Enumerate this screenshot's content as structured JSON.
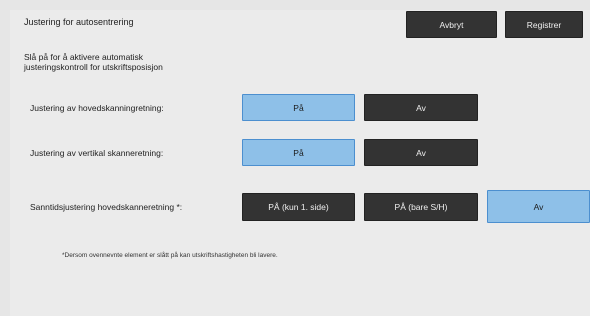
{
  "header": {
    "title": "Justering for autosentrering",
    "cancel_label": "Avbryt",
    "register_label": "Registrer"
  },
  "description": "Slå på for å aktivere automatisk\njusteringskontroll for utskriftsposisjon",
  "settings": [
    {
      "label": "Justering av hovedskanningretning:",
      "options": [
        "På",
        "Av"
      ],
      "selected": "På"
    },
    {
      "label": "Justering av vertikal skanneretning:",
      "options": [
        "På",
        "Av"
      ],
      "selected": "På"
    },
    {
      "label": "Sanntidsjustering hovedskanneretning *:",
      "options": [
        "PÅ (kun 1. side)",
        "PÅ (bare S/H)",
        "Av"
      ],
      "selected": "Av"
    }
  ],
  "footnote": "*Dersom ovennevnte element er slått på kan utskriftshastigheten bli lavere.",
  "colors": {
    "selected": "#8ec0e8",
    "unselected": "#333333",
    "background": "#ebebeb"
  }
}
